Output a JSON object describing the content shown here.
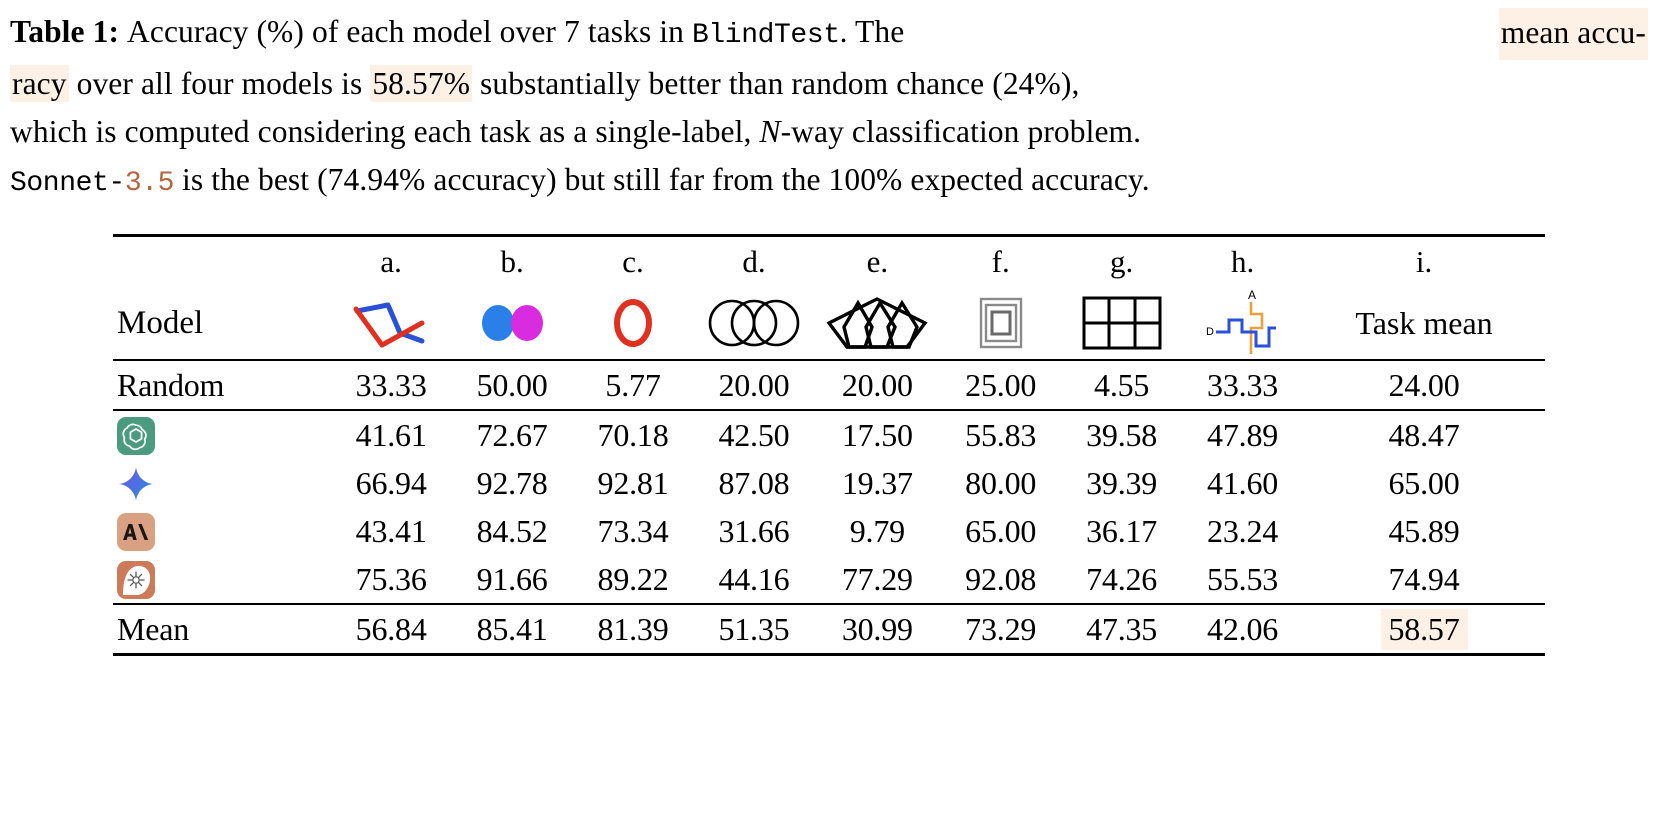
{
  "caption": {
    "label": "Table 1:",
    "line1_a": "Accuracy (%) of each model over 7 tasks in",
    "line1_mono": "BlindTest",
    "line1_b": ". The",
    "line1_hl": "mean accu-",
    "line2_hl_head": "racy",
    "line2_a": "over all four models is",
    "line2_hl_val": "58.57%",
    "line2_b": "substantially better than random chance (24%),",
    "line3": "which is computed considering each task as a single-label,",
    "line3_italic": "N",
    "line3_b": "-way classification problem.",
    "line4_mono": "Sonnet-",
    "line4_mono_num": "3.5",
    "line4_a": "is the best (74.94% accuracy) but still far from the 100% expected accuracy."
  },
  "table": {
    "model_header": "Model",
    "task_mean_header": "Task mean",
    "letters": [
      "a.",
      "b.",
      "c.",
      "d.",
      "e.",
      "f.",
      "g.",
      "h.",
      "i."
    ],
    "icon_names": [
      "line-intersection-icon",
      "touching-circles-icon",
      "red-circle-icon",
      "overlapping-circles-icon",
      "nested-pentagons-icon",
      "nested-squares-icon",
      "grid-count-icon",
      "subway-map-icon"
    ],
    "rows": [
      {
        "label": "Random",
        "logo": null,
        "values": [
          "33.33",
          "50.00",
          "5.77",
          "20.00",
          "20.00",
          "25.00",
          "4.55",
          "33.33"
        ],
        "bold": [
          false,
          false,
          false,
          false,
          false,
          false,
          false,
          false
        ],
        "mean": "24.00",
        "mean_bold": false,
        "mean_highlight": false
      },
      {
        "label": "",
        "logo": "openai-logo",
        "values": [
          "41.61",
          "72.67",
          "70.18",
          "42.50",
          "17.50",
          "55.83",
          "39.58",
          "47.89"
        ],
        "bold": [
          false,
          false,
          false,
          false,
          false,
          false,
          false,
          false
        ],
        "mean": "48.47",
        "mean_bold": false,
        "mean_highlight": false
      },
      {
        "label": "",
        "logo": "gemini-logo",
        "values": [
          "66.94",
          "92.78",
          "92.81",
          "87.08",
          "19.37",
          "80.00",
          "39.39",
          "41.60"
        ],
        "bold": [
          false,
          true,
          true,
          true,
          false,
          false,
          false,
          false
        ],
        "mean": "65.00",
        "mean_bold": false,
        "mean_highlight": false
      },
      {
        "label": "",
        "logo": "anthropic-logo",
        "values": [
          "43.41",
          "84.52",
          "73.34",
          "31.66",
          "9.79",
          "65.00",
          "36.17",
          "23.24"
        ],
        "bold": [
          false,
          false,
          false,
          false,
          false,
          false,
          false,
          false
        ],
        "mean": "45.89",
        "mean_bold": false,
        "mean_highlight": false
      },
      {
        "label": "",
        "logo": "sonnet-logo",
        "values": [
          "75.36",
          "91.66",
          "89.22",
          "44.16",
          "77.29",
          "92.08",
          "74.26",
          "55.53"
        ],
        "bold": [
          true,
          false,
          false,
          false,
          true,
          true,
          true,
          true
        ],
        "mean": "74.94",
        "mean_bold": true,
        "mean_highlight": false
      },
      {
        "label": "Mean",
        "logo": null,
        "values": [
          "56.84",
          "85.41",
          "81.39",
          "51.35",
          "30.99",
          "73.29",
          "47.35",
          "42.06"
        ],
        "bold": [
          false,
          false,
          false,
          false,
          false,
          false,
          false,
          false
        ],
        "mean": "58.57",
        "mean_bold": false,
        "mean_highlight": true
      }
    ]
  },
  "colors": {
    "highlight_bg": "#fdf1e6",
    "accent_number": "#b5653f",
    "icon_blue": "#2b4fd8",
    "icon_red": "#e03020",
    "icon_dot_blue": "#2b7fe8",
    "icon_dot_magenta": "#d92be0",
    "icon_orange": "#e8a13c",
    "icon_gray": "#8a8a8a",
    "openai_green": "#4a9b7f",
    "anthropic_tan": "#d9a182",
    "sonnet_orange": "#cc7a58"
  }
}
